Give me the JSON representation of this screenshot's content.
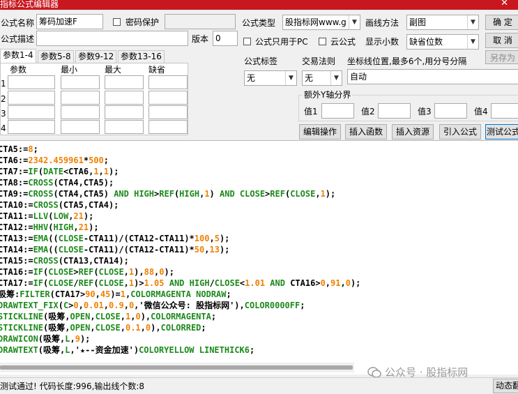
{
  "window": {
    "title": "指标公式编辑器",
    "close": "✕"
  },
  "form": {
    "name_label": "公式名称",
    "name_value": "筹码加速F",
    "password_label": "密码保护",
    "desc_label": "公式描述",
    "version_label": "版本",
    "version_value": "0",
    "type_label": "公式类型",
    "type_value": "股指标网www.g",
    "draw_label": "画线方法",
    "draw_value": "副图",
    "pc_only_label": "公式只用于PC",
    "cloud_label": "云公式",
    "decimals_label": "显示小数",
    "decimals_value": "缺省位数"
  },
  "buttons": {
    "ok": "确 定",
    "cancel": "取 消",
    "save_as": "另存为",
    "edit_ops": "编辑操作",
    "insert_func": "插入函数",
    "insert_res": "插入资源",
    "import": "引入公式",
    "test": "测试公式",
    "dynamic": "动态翻"
  },
  "tabs": [
    "参数1-4",
    "参数5-8",
    "参数9-12",
    "参数13-16"
  ],
  "params": {
    "headers": [
      "参数",
      "最小",
      "最大",
      "缺省"
    ],
    "rows": [
      "1",
      "2",
      "3",
      "4"
    ]
  },
  "right": {
    "tag_label": "公式标签",
    "tag_value": "无",
    "trade_label": "交易法则",
    "trade_value": "无",
    "coord_label": "坐标线位置,最多6个,用分号分隔",
    "coord_value": "自动",
    "yaxis_label": "额外Y轴分界",
    "val_labels": [
      "值1",
      "值2",
      "值3",
      "值4"
    ]
  },
  "code_lines": [
    [
      [
        "txt",
        "CTA5:="
      ],
      [
        "num",
        "8"
      ],
      [
        "txt",
        ";"
      ]
    ],
    [
      [
        "txt",
        "CTA6:="
      ],
      [
        "num",
        "2342.459961"
      ],
      [
        "txt",
        "*"
      ],
      [
        "num",
        "500"
      ],
      [
        "txt",
        ";"
      ]
    ],
    [
      [
        "txt",
        "CTA7:="
      ],
      [
        "fn",
        "IF"
      ],
      [
        "txt",
        "("
      ],
      [
        "fn",
        "DATE"
      ],
      [
        "txt",
        "<CTA6,"
      ],
      [
        "num",
        "1"
      ],
      [
        "txt",
        ","
      ],
      [
        "num",
        "1"
      ],
      [
        "txt",
        ");"
      ]
    ],
    [
      [
        "txt",
        "CTA8:="
      ],
      [
        "fn",
        "CROSS"
      ],
      [
        "txt",
        "(CTA4,CTA5);"
      ]
    ],
    [
      [
        "txt",
        "CTA9:="
      ],
      [
        "fn",
        "CROSS"
      ],
      [
        "txt",
        "(CTA4,CTA5) "
      ],
      [
        "fn",
        "AND"
      ],
      [
        "txt",
        " "
      ],
      [
        "fn",
        "HIGH"
      ],
      [
        "txt",
        ">"
      ],
      [
        "fn",
        "REF"
      ],
      [
        "txt",
        "("
      ],
      [
        "fn",
        "HIGH"
      ],
      [
        "txt",
        ","
      ],
      [
        "num",
        "1"
      ],
      [
        "txt",
        ") "
      ],
      [
        "fn",
        "AND"
      ],
      [
        "txt",
        " "
      ],
      [
        "fn",
        "CLOSE"
      ],
      [
        "txt",
        ">"
      ],
      [
        "fn",
        "REF"
      ],
      [
        "txt",
        "("
      ],
      [
        "fn",
        "CLOSE"
      ],
      [
        "txt",
        ","
      ],
      [
        "num",
        "1"
      ],
      [
        "txt",
        ");"
      ]
    ],
    [
      [
        "txt",
        "CTA10:="
      ],
      [
        "fn",
        "CROSS"
      ],
      [
        "txt",
        "(CTA5,CTA4);"
      ]
    ],
    [
      [
        "txt",
        "CTA11:="
      ],
      [
        "fn",
        "LLV"
      ],
      [
        "txt",
        "("
      ],
      [
        "fn",
        "LOW"
      ],
      [
        "txt",
        ","
      ],
      [
        "num",
        "21"
      ],
      [
        "txt",
        ");"
      ]
    ],
    [
      [
        "txt",
        "CTA12:="
      ],
      [
        "fn",
        "HHV"
      ],
      [
        "txt",
        "("
      ],
      [
        "fn",
        "HIGH"
      ],
      [
        "txt",
        ","
      ],
      [
        "num",
        "21"
      ],
      [
        "txt",
        ");"
      ]
    ],
    [
      [
        "txt",
        "CTA13:="
      ],
      [
        "fn",
        "EMA"
      ],
      [
        "txt",
        "(("
      ],
      [
        "fn",
        "CLOSE"
      ],
      [
        "txt",
        "-CTA11)/(CTA12-CTA11)*"
      ],
      [
        "num",
        "100"
      ],
      [
        "txt",
        ","
      ],
      [
        "num",
        "5"
      ],
      [
        "txt",
        ");"
      ]
    ],
    [
      [
        "txt",
        "CTA14:="
      ],
      [
        "fn",
        "EMA"
      ],
      [
        "txt",
        "(("
      ],
      [
        "fn",
        "CLOSE"
      ],
      [
        "txt",
        "-CTA11)/(CTA12-CTA11)*"
      ],
      [
        "num",
        "50"
      ],
      [
        "txt",
        ","
      ],
      [
        "num",
        "13"
      ],
      [
        "txt",
        ");"
      ]
    ],
    [
      [
        "txt",
        "CTA15:="
      ],
      [
        "fn",
        "CROSS"
      ],
      [
        "txt",
        "(CTA13,CTA14);"
      ]
    ],
    [
      [
        "txt",
        "CTA16:="
      ],
      [
        "fn",
        "IF"
      ],
      [
        "txt",
        "("
      ],
      [
        "fn",
        "CLOSE"
      ],
      [
        "txt",
        ">"
      ],
      [
        "fn",
        "REF"
      ],
      [
        "txt",
        "("
      ],
      [
        "fn",
        "CLOSE"
      ],
      [
        "txt",
        ","
      ],
      [
        "num",
        "1"
      ],
      [
        "txt",
        "),"
      ],
      [
        "num",
        "88"
      ],
      [
        "txt",
        ","
      ],
      [
        "num",
        "0"
      ],
      [
        "txt",
        ");"
      ]
    ],
    [
      [
        "txt",
        "CTA17:="
      ],
      [
        "fn",
        "IF"
      ],
      [
        "txt",
        "("
      ],
      [
        "fn",
        "CLOSE"
      ],
      [
        "txt",
        "/"
      ],
      [
        "fn",
        "REF"
      ],
      [
        "txt",
        "("
      ],
      [
        "fn",
        "CLOSE"
      ],
      [
        "txt",
        ","
      ],
      [
        "num",
        "1"
      ],
      [
        "txt",
        ")>"
      ],
      [
        "num",
        "1.05"
      ],
      [
        "txt",
        " "
      ],
      [
        "fn",
        "AND"
      ],
      [
        "txt",
        " "
      ],
      [
        "fn",
        "HIGH"
      ],
      [
        "txt",
        "/"
      ],
      [
        "fn",
        "CLOSE"
      ],
      [
        "txt",
        "<"
      ],
      [
        "num",
        "1.01"
      ],
      [
        "txt",
        " "
      ],
      [
        "fn",
        "AND"
      ],
      [
        "txt",
        " CTA16>"
      ],
      [
        "num",
        "0"
      ],
      [
        "txt",
        ","
      ],
      [
        "num",
        "91"
      ],
      [
        "txt",
        ","
      ],
      [
        "num",
        "0"
      ],
      [
        "txt",
        ");"
      ]
    ],
    [
      [
        "txt",
        "吸筹:"
      ],
      [
        "fn",
        "FILTER"
      ],
      [
        "txt",
        "(CTA17>"
      ],
      [
        "num",
        "90"
      ],
      [
        "txt",
        ","
      ],
      [
        "num",
        "45"
      ],
      [
        "txt",
        ")="
      ],
      [
        "num",
        "1"
      ],
      [
        "txt",
        ","
      ],
      [
        "cn",
        "COLORMAGENTA NODRAW"
      ],
      [
        "txt",
        ";"
      ]
    ],
    [
      [
        "fn",
        "DRAWTEXT_FIX"
      ],
      [
        "txt",
        "("
      ],
      [
        "fn",
        "C"
      ],
      [
        "txt",
        ">"
      ],
      [
        "num",
        "0"
      ],
      [
        "txt",
        ","
      ],
      [
        "num",
        "0.01"
      ],
      [
        "txt",
        ","
      ],
      [
        "num",
        "0.9"
      ],
      [
        "txt",
        ","
      ],
      [
        "num",
        "0"
      ],
      [
        "txt",
        ",'微信公众号: 股指标网'),"
      ],
      [
        "cn",
        "COLOR0000FF"
      ],
      [
        "txt",
        ";"
      ]
    ],
    [
      [
        "fn",
        "STICKLINE"
      ],
      [
        "txt",
        "(吸筹,"
      ],
      [
        "fn",
        "OPEN"
      ],
      [
        "txt",
        ","
      ],
      [
        "fn",
        "CLOSE"
      ],
      [
        "txt",
        ","
      ],
      [
        "num",
        "1"
      ],
      [
        "txt",
        ","
      ],
      [
        "num",
        "0"
      ],
      [
        "txt",
        "),"
      ],
      [
        "cn",
        "COLORMAGENTA"
      ],
      [
        "txt",
        ";"
      ]
    ],
    [
      [
        "fn",
        "STICKLINE"
      ],
      [
        "txt",
        "(吸筹,"
      ],
      [
        "fn",
        "OPEN"
      ],
      [
        "txt",
        ","
      ],
      [
        "fn",
        "CLOSE"
      ],
      [
        "txt",
        ","
      ],
      [
        "num",
        "0.1"
      ],
      [
        "txt",
        ","
      ],
      [
        "num",
        "0"
      ],
      [
        "txt",
        "),"
      ],
      [
        "cn",
        "COLORRED"
      ],
      [
        "txt",
        ";"
      ]
    ],
    [
      [
        "fn",
        "DRAWICON"
      ],
      [
        "txt",
        "(吸筹,"
      ],
      [
        "fn",
        "L"
      ],
      [
        "txt",
        ","
      ],
      [
        "num",
        "9"
      ],
      [
        "txt",
        ");"
      ]
    ],
    [
      [
        "fn",
        "DRAWTEXT"
      ],
      [
        "txt",
        "(吸筹,"
      ],
      [
        "fn",
        "L"
      ],
      [
        "txt",
        ",'★--资金加速')"
      ],
      [
        "cn",
        "COLORYELLOW LINETHICK6"
      ],
      [
        "txt",
        ";"
      ]
    ]
  ],
  "watermark": "公众号 · 股指标网",
  "status": "测试通过! 代码长度:996,输出线个数:8"
}
